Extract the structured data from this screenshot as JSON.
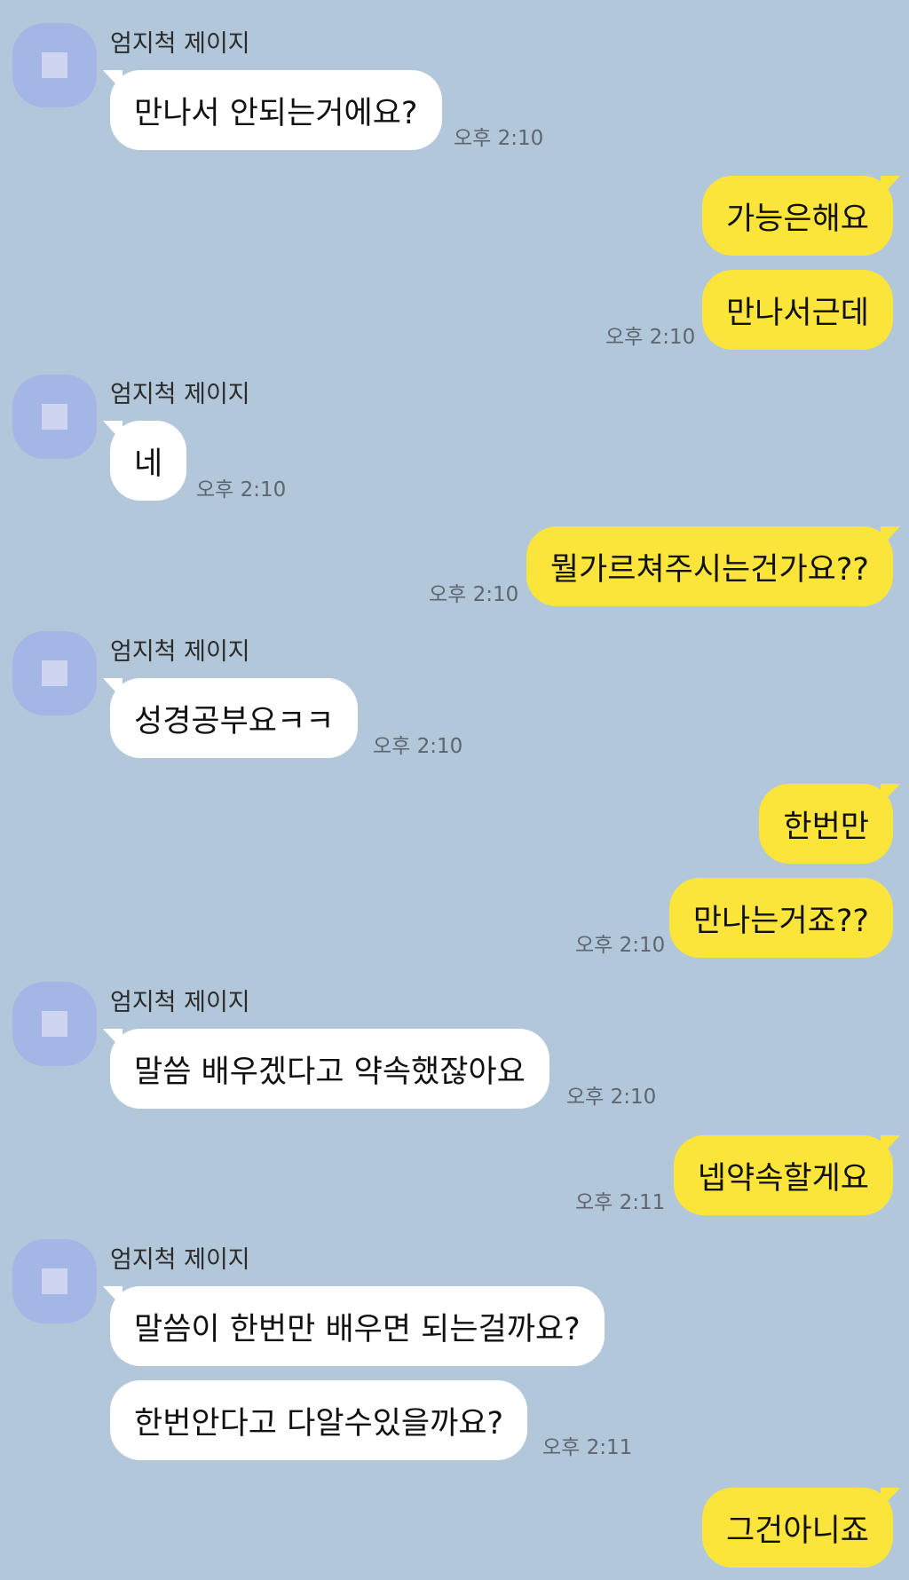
{
  "colors": {
    "background": "#b2c7da",
    "incoming_bubble": "#ffffff",
    "outgoing_bubble": "#fbe53b",
    "avatar": "#a4b6e6"
  },
  "sender_name": "엄지척 제이지",
  "messages": [
    {
      "id": 1,
      "text": "만나서 안되는거에요?",
      "time": "오후 2:10",
      "direction": "incoming"
    },
    {
      "id": 2,
      "text": "가능은해요",
      "direction": "outgoing"
    },
    {
      "id": 3,
      "text": "만나서근데",
      "time": "오후 2:10",
      "direction": "outgoing"
    },
    {
      "id": 4,
      "text": "네",
      "time": "오후 2:10",
      "direction": "incoming"
    },
    {
      "id": 5,
      "text": "뭘가르쳐주시는건가요??",
      "time": "오후 2:10",
      "direction": "outgoing"
    },
    {
      "id": 6,
      "text": "성경공부요ㅋㅋ",
      "time": "오후 2:10",
      "direction": "incoming"
    },
    {
      "id": 7,
      "text": "한번만",
      "direction": "outgoing"
    },
    {
      "id": 8,
      "text": "만나는거죠??",
      "time": "오후 2:10",
      "direction": "outgoing"
    },
    {
      "id": 9,
      "text": "말씀 배우겠다고 약속했잖아요",
      "time": "오후 2:10",
      "direction": "incoming"
    },
    {
      "id": 10,
      "text": "넵약속할게요",
      "time": "오후 2:11",
      "direction": "outgoing"
    },
    {
      "id": 11,
      "text": "말씀이 한번만 배우면 되는걸까요?",
      "direction": "incoming"
    },
    {
      "id": 12,
      "text": "한번안다고 다알수있을까요?",
      "time": "오후 2:11",
      "direction": "incoming"
    },
    {
      "id": 13,
      "text": "그건아니죠",
      "direction": "outgoing"
    }
  ]
}
